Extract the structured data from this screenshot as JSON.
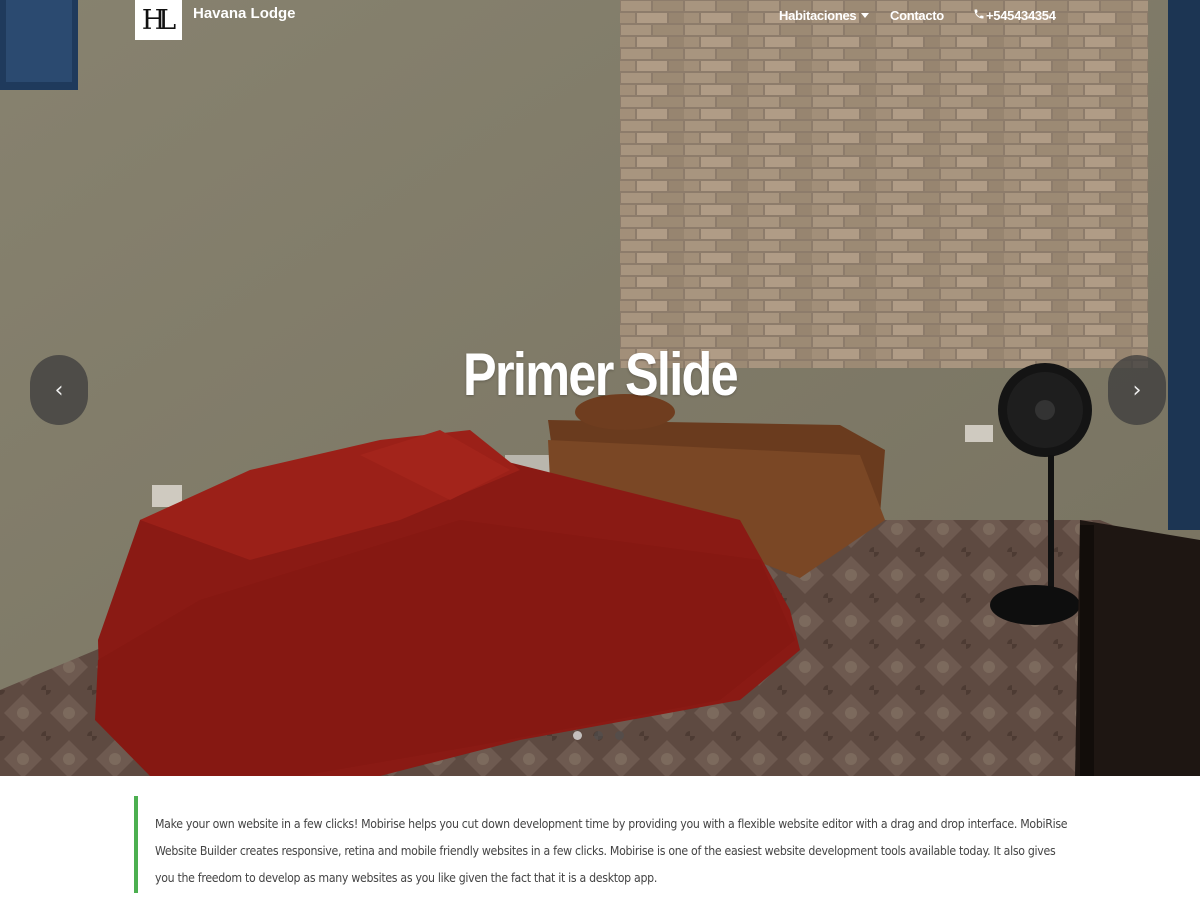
{
  "navbar": {
    "logo_monogram": "HL",
    "brand_name": "Havana Lodge",
    "items": [
      {
        "label": "Habitaciones",
        "has_dropdown": true
      },
      {
        "label": "Contacto"
      }
    ],
    "phone": "+545434354",
    "phone_icon": "phone-icon"
  },
  "carousel": {
    "slide_title": "Primer Slide",
    "prev_label": "‹",
    "next_label": "›",
    "indicator_count": 3,
    "active_index": 0
  },
  "content": {
    "text": "Make your own website in a few clicks! Mobirise helps you cut down development time by providing you with a flexible website editor with a drag and drop interface. MobiRise Website Builder creates responsive, retina and mobile friendly websites in a few clicks. Mobirise is one of the easiest website development tools available today. It also gives you the freedom to develop as many websites as you like given the fact that it is a desktop app.",
    "accent_color": "#4caf50"
  }
}
